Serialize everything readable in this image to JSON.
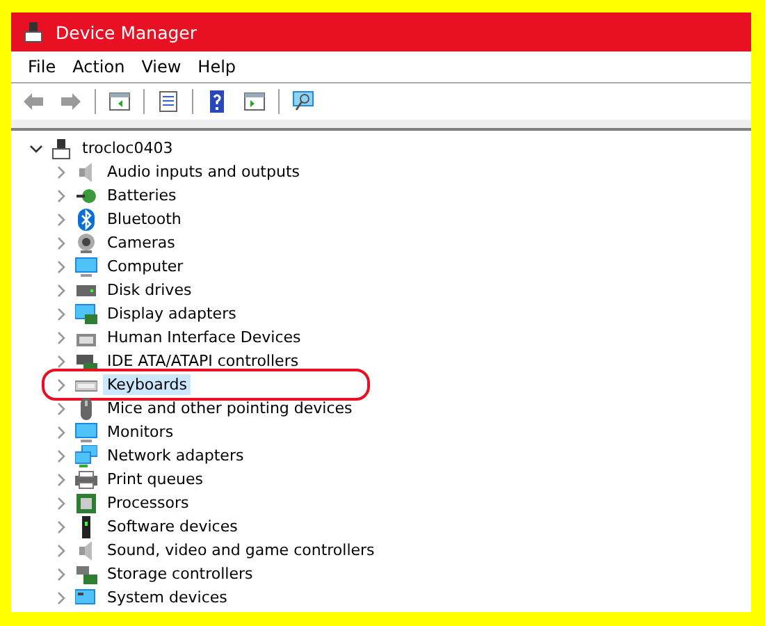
{
  "window": {
    "title": "Device Manager"
  },
  "menu": [
    "File",
    "Action",
    "View",
    "Help"
  ],
  "toolbar": [
    {
      "kind": "back",
      "disabled": true
    },
    {
      "kind": "forward",
      "disabled": true
    },
    {
      "kind": "sep"
    },
    {
      "kind": "pane"
    },
    {
      "kind": "sep"
    },
    {
      "kind": "properties"
    },
    {
      "kind": "sep"
    },
    {
      "kind": "help"
    },
    {
      "kind": "run"
    },
    {
      "kind": "sep"
    },
    {
      "kind": "scan"
    }
  ],
  "tree": {
    "label": "trocloc0403",
    "expanded": true,
    "children": [
      {
        "label": "Audio inputs and outputs",
        "kind": "speaker",
        "expanded": false,
        "selected": false,
        "annotated": false
      },
      {
        "label": "Batteries",
        "kind": "battery",
        "expanded": false,
        "selected": false,
        "annotated": false
      },
      {
        "label": "Bluetooth",
        "kind": "bluetooth",
        "expanded": false,
        "selected": false,
        "annotated": false
      },
      {
        "label": "Cameras",
        "kind": "camera",
        "expanded": false,
        "selected": false,
        "annotated": false
      },
      {
        "label": "Computer",
        "kind": "monitor",
        "expanded": false,
        "selected": false,
        "annotated": false
      },
      {
        "label": "Disk drives",
        "kind": "disk",
        "expanded": false,
        "selected": false,
        "annotated": false
      },
      {
        "label": "Display adapters",
        "kind": "display",
        "expanded": false,
        "selected": false,
        "annotated": false
      },
      {
        "label": "Human Interface Devices",
        "kind": "hid",
        "expanded": false,
        "selected": false,
        "annotated": false
      },
      {
        "label": "IDE ATA/ATAPI controllers",
        "kind": "controller",
        "expanded": false,
        "selected": false,
        "annotated": false
      },
      {
        "label": "Keyboards",
        "kind": "keyboard",
        "expanded": false,
        "selected": true,
        "annotated": true
      },
      {
        "label": "Mice and other pointing devices",
        "kind": "mouse",
        "expanded": false,
        "selected": false,
        "annotated": false
      },
      {
        "label": "Monitors",
        "kind": "monitor",
        "expanded": false,
        "selected": false,
        "annotated": false
      },
      {
        "label": "Network adapters",
        "kind": "network",
        "expanded": false,
        "selected": false,
        "annotated": false
      },
      {
        "label": "Print queues",
        "kind": "printer",
        "expanded": false,
        "selected": false,
        "annotated": false
      },
      {
        "label": "Processors",
        "kind": "chip",
        "expanded": false,
        "selected": false,
        "annotated": false
      },
      {
        "label": "Software devices",
        "kind": "tower",
        "expanded": false,
        "selected": false,
        "annotated": false
      },
      {
        "label": "Sound, video and game controllers",
        "kind": "speaker",
        "expanded": false,
        "selected": false,
        "annotated": false
      },
      {
        "label": "Storage controllers",
        "kind": "storage",
        "expanded": false,
        "selected": false,
        "annotated": false
      },
      {
        "label": "System devices",
        "kind": "system",
        "expanded": false,
        "selected": false,
        "annotated": false
      }
    ]
  }
}
